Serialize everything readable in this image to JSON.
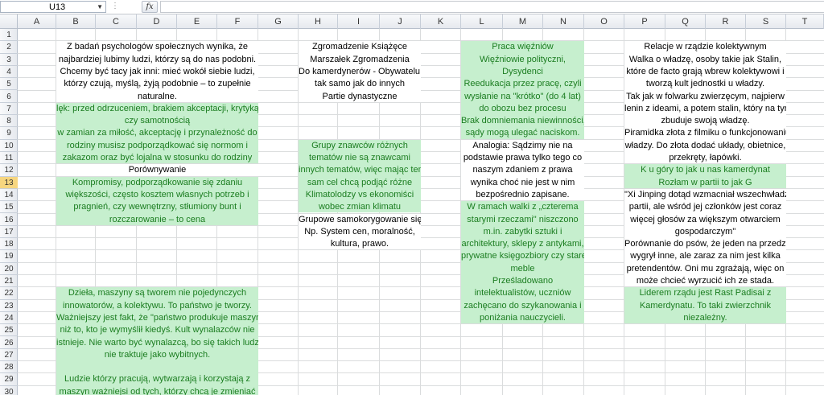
{
  "formula_bar": {
    "name_box": "U13",
    "dots": "⋮",
    "fx": "fx",
    "formula": ""
  },
  "active_row": 13,
  "colors": {
    "green_fill": "#c6efce",
    "green_text": "#1b7d20",
    "grid": "#dadcdd",
    "active_header": "#f7d67f"
  },
  "columns": [
    "A",
    "B",
    "C",
    "D",
    "E",
    "F",
    "G",
    "H",
    "I",
    "J",
    "K",
    "L",
    "M",
    "N",
    "O",
    "P",
    "Q",
    "R",
    "S",
    "T"
  ],
  "rows": [
    "1",
    "2",
    "3",
    "4",
    "5",
    "6",
    "7",
    "8",
    "9",
    "10",
    "11",
    "12",
    "13",
    "14",
    "15",
    "16",
    "17",
    "18",
    "19",
    "20",
    "21",
    "22",
    "23",
    "24",
    "25",
    "26",
    "27",
    "28",
    "29",
    "30"
  ],
  "blocks": [
    {
      "col": "B",
      "row": 2,
      "green": false,
      "lines": [
        "Z badań psychologów społecznych wynika, że",
        "najbardziej lubimy ludzi, którzy są do nas podobni.",
        "Chcemy być tacy jak inni: mieć wokół siebie ludzi,",
        "którzy czują, myślą, żyją podobnie – to zupełnie",
        "naturalne."
      ]
    },
    {
      "col": "B",
      "row": 7,
      "green": true,
      "lines": [
        "lęk: przed odrzuceniem, brakiem akceptacji, krytyką",
        "czy samotnością",
        "w zamian za miłość, akceptację i przynależność do",
        "rodziny musisz podporządkować się normom i",
        "zakazom oraz być lojalna w stosunku do rodziny"
      ]
    },
    {
      "col": "B",
      "row": 12,
      "green": false,
      "lines": [
        "Porównywanie"
      ]
    },
    {
      "col": "B",
      "row": 13,
      "green": true,
      "lines": [
        "Kompromisy, podporządkowanie się zdaniu",
        "większości, często kosztem własnych potrzeb i",
        "pragnień, czy wewnętrzny, stłumiony bunt i",
        "rozczarowanie – to cena"
      ]
    },
    {
      "col": "B",
      "row": 22,
      "green": true,
      "lines": [
        "Dzieła, maszyny są tworem nie pojedynczych",
        "innowatorów, a kolektywu. To państwo je tworzy.",
        "Ważniejszy jest fakt, że \"państwo produkuje maszyny\"",
        "niż to, kto je wymyślił kiedyś. Kult wynalazców nie",
        "istnieje. Nie warto być wynalazcą, bo się takich ludzi",
        "nie traktuje jako wybitnych.",
        "",
        "Ludzie którzy pracują, wytwarzają i korzystają z",
        "maszyn ważniejsi od tych, którzy chcą je zmieniać"
      ]
    },
    {
      "col": "H",
      "row": 2,
      "green": false,
      "lines": [
        "Zgromadzenie Książęce",
        "Marszałek Zgromadzenia",
        "Do kamerdynerów - Obywatelu,",
        "tak samo jak do innych",
        "Partie dynastyczne"
      ]
    },
    {
      "col": "H",
      "row": 10,
      "green": true,
      "lines": [
        "Grupy znawców różnych",
        "tematów nie są znawcami",
        "innych tematów, więc mając ten",
        "sam cel chcą podjąć różne",
        "Klimatolodzy vs ekonomiści",
        "wobec zmian klimatu"
      ]
    },
    {
      "col": "H",
      "row": 16,
      "green": false,
      "lines": [
        "Grupowe samokorygowanie się",
        "Np. System cen, moralność,",
        "kultura, prawo."
      ]
    },
    {
      "col": "L",
      "row": 2,
      "green": true,
      "lines": [
        "Praca więźniów",
        "Więźniowie polityczni,",
        "Dysydenci",
        "Reedukacja przez pracę, czyli",
        "wysłanie na \"krótko\" (do 4 lat)",
        "do obozu bez procesu",
        "Brak domniemania niewinności,",
        "sądy mogą ulegać naciskom."
      ]
    },
    {
      "col": "L",
      "row": 10,
      "green": false,
      "lines": [
        "Analogia: Sądzimy nie na",
        "podstawie prawa tylko tego co",
        "naszym zdaniem z prawa",
        "wynika choć nie jest w nim",
        "bezpośrednio zapisane."
      ]
    },
    {
      "col": "L",
      "row": 15,
      "green": true,
      "lines": [
        "W ramach walki z „czterema",
        "starymi rzeczami\" niszczono",
        "m.in. zabytki sztuki i",
        "architektury, sklepy z antykami,",
        "prywatne księgozbiory czy stare",
        "meble",
        "Prześladowano",
        "intelektualistów, uczniów",
        "zachęcano do szykanowania i",
        "poniżania nauczycieli."
      ]
    },
    {
      "col": "P",
      "row": 2,
      "green": false,
      "lines": [
        "Relacje w rządzie kolektywnym",
        "Walka o władzę, osoby takie jak Stalin,",
        "które de facto grają wbrew kolektywowi i",
        "tworzą kult jednostki u władzy.",
        "Tak jak w folwarku zwierzęcym, najpierw",
        "lenin z ideami, a potem stalin, który na tym",
        "zbuduje swoją władzę.",
        "Piramidka złota z filmiku o funkcjonowaniu",
        "władzy. Do złota dodać układy, obietnice,",
        "przekręty, łapówki."
      ]
    },
    {
      "col": "P",
      "row": 12,
      "green": true,
      "lines": [
        "K u góry to jak u nas kamerdynat",
        "Rozłam w partii to jak G"
      ]
    },
    {
      "col": "P",
      "row": 14,
      "green": false,
      "lines": [
        "\"Xi Jinping dotąd wzmacniał wszechwładzę",
        "partii, ale wśród jej członków jest coraz",
        "więcej głosów za większym otwarciem",
        "gospodarczym\"",
        "Porównanie do psów, że jeden na przedzie",
        "wygrył inne, ale zaraz za nim jest kilka",
        "pretendentów. Oni mu zgrażają, więc on",
        "może chcieć wyrzucić ich ze stada."
      ]
    },
    {
      "col": "P",
      "row": 22,
      "green": true,
      "lines": [
        "Liderem rządu jest Rast Padisai z",
        "Kamerdynatu. To taki zwierzchnik",
        "niezależny."
      ]
    }
  ]
}
